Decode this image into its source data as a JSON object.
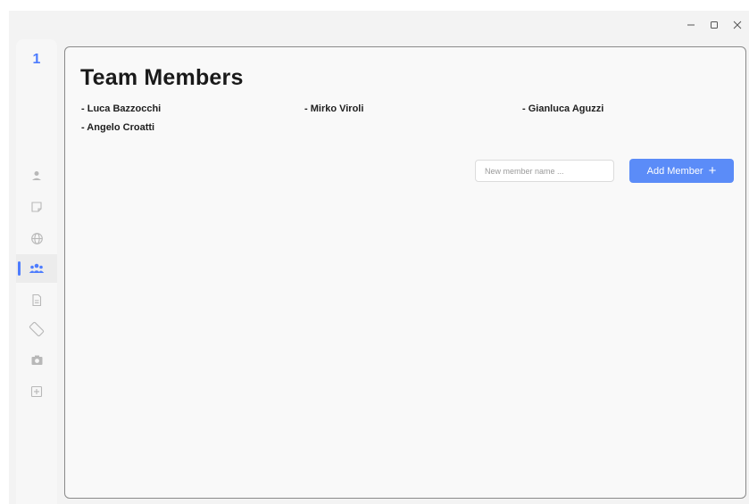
{
  "window_controls": {
    "minimize_icon": "minimize-icon",
    "maximize_icon": "maximize-icon",
    "close_icon": "close-icon"
  },
  "sidebar": {
    "brand": "1",
    "items": [
      {
        "name": "user-icon",
        "active": false
      },
      {
        "name": "note-icon",
        "active": false
      },
      {
        "name": "globe-icon",
        "active": false
      },
      {
        "name": "team-icon",
        "active": true
      },
      {
        "name": "document-icon",
        "active": false
      },
      {
        "name": "rotate-icon",
        "active": false
      },
      {
        "name": "camera-icon",
        "active": false
      },
      {
        "name": "add-box-icon",
        "active": false
      }
    ]
  },
  "main": {
    "title": "Team Members",
    "members": [
      "- Luca Bazzocchi",
      "- Mirko Viroli",
      "- Gianluca Aguzzi",
      "- Angelo Croatti"
    ],
    "input_placeholder": "New member name ...",
    "add_button_label": "Add Member",
    "add_button_icon": "+"
  },
  "colors": {
    "accent": "#4d7cfe",
    "button": "#5b8cf8"
  }
}
